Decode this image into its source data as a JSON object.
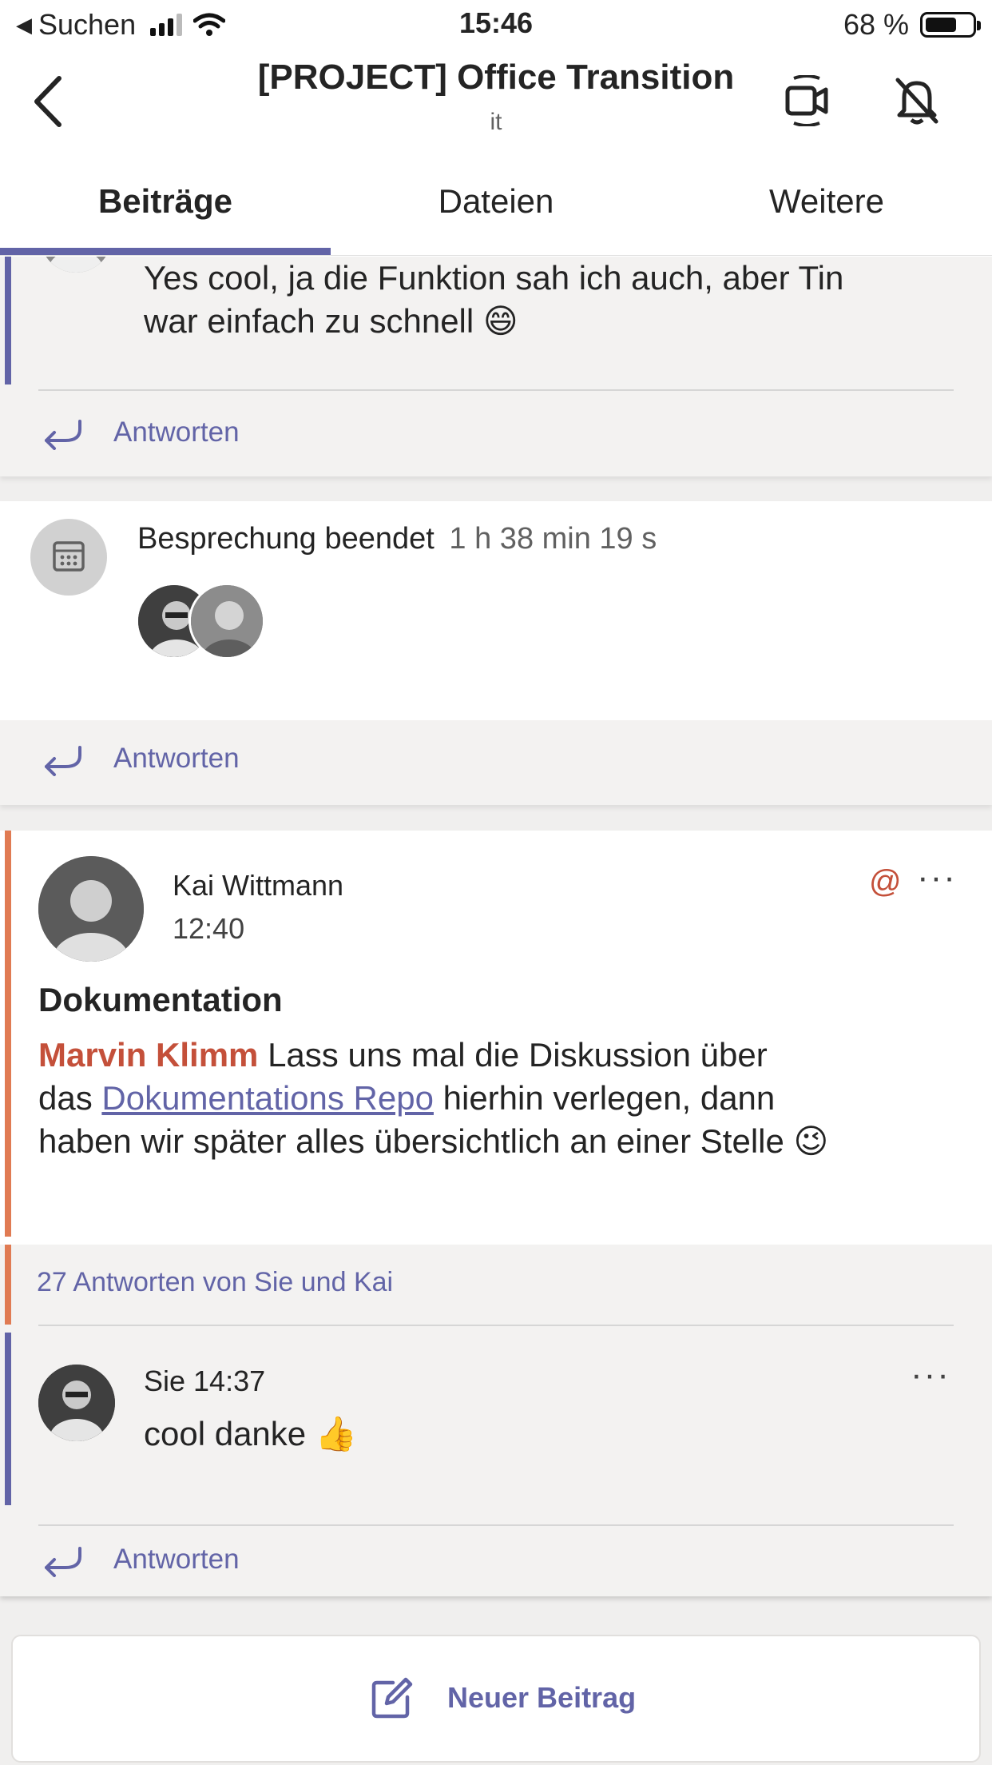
{
  "status_bar": {
    "back_app": "Suchen",
    "time": "15:46",
    "battery": "68 %",
    "battery_level": 0.68
  },
  "header": {
    "title": "[PROJECT] Office Transition",
    "subtitle": "it",
    "icons": [
      "back-chevron-icon",
      "video-call-icon",
      "bell-off-icon"
    ]
  },
  "tabs": [
    {
      "label": "Beiträge",
      "active": true
    },
    {
      "label": "Dateien",
      "active": false
    },
    {
      "label": "Weitere",
      "active": false
    }
  ],
  "feed": {
    "thread1": {
      "text_line1": "Yes cool, ja die Funktion sah ich auch, aber Tin",
      "text_line2": "war einfach zu schnell",
      "emoji": "😄",
      "reply_label": "Antworten"
    },
    "meeting": {
      "title": "Besprechung beendet",
      "duration": "1 h 38 min 19 s",
      "reply_label": "Antworten"
    },
    "post": {
      "author": "Kai Wittmann",
      "time": "12:40",
      "subject": "Dokumentation",
      "mention": "Marvin Klimm",
      "text_a": " Lass uns mal die Diskussion über",
      "text_b": "das ",
      "link": "Dokumentations Repo",
      "text_c": " hierhin verlegen, dann",
      "text_d": "haben wir später alles übersichtlich an einer Stelle",
      "emoji": "😉",
      "at_symbol": "@",
      "more": "···",
      "replies_summary": "27 Antworten von Sie und Kai",
      "reply": {
        "author_time": "Sie 14:37",
        "text": "cool danke",
        "emoji": "👍",
        "more": "···"
      },
      "reply_label": "Antworten"
    }
  },
  "new_post": {
    "label": "Neuer Beitrag"
  },
  "colors": {
    "accent_purple": "#6264a7",
    "accent_orange": "#e07b53",
    "mention_red": "#c4503a"
  }
}
